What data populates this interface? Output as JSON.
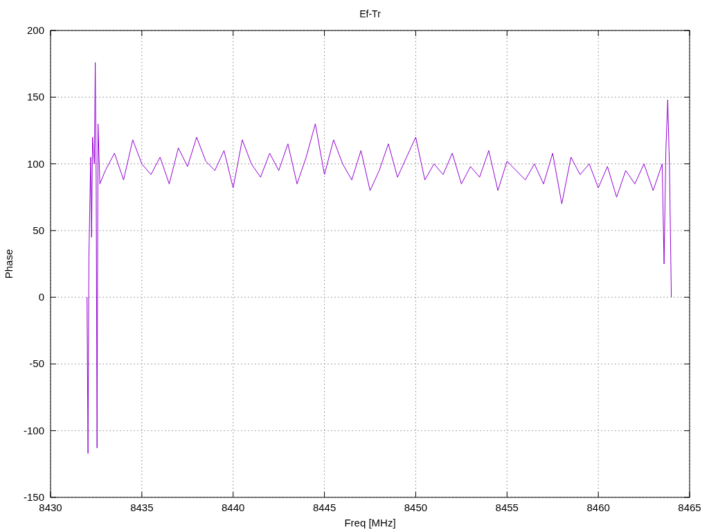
{
  "plot": {
    "chart_data": {
      "type": "line",
      "grid": true,
      "title": "Ef-Tr",
      "xlabel": "Freq [MHz]",
      "ylabel": "Phase",
      "xlim": [
        8430,
        8465
      ],
      "ylim": [
        -150,
        200
      ],
      "xticks": [
        8430,
        8435,
        8440,
        8445,
        8450,
        8455,
        8460,
        8465
      ],
      "yticks": [
        -150,
        -100,
        -50,
        0,
        50,
        100,
        150,
        200
      ],
      "x": [
        8432.0,
        8432.05,
        8432.1,
        8432.2,
        8432.25,
        8432.3,
        8432.4,
        8432.45,
        8432.5,
        8432.55,
        8432.6,
        8432.7,
        8433,
        8433.5,
        8434,
        8434.5,
        8435,
        8435.5,
        8436,
        8436.5,
        8437,
        8437.5,
        8438,
        8438.5,
        8439,
        8439.5,
        8440,
        8440.5,
        8441,
        8441.5,
        8442,
        8442.5,
        8443,
        8443.5,
        8444,
        8444.5,
        8445,
        8445.5,
        8446,
        8446.5,
        8447,
        8447.5,
        8448,
        8448.5,
        8449,
        8449.5,
        8450,
        8450.5,
        8451,
        8451.5,
        8452,
        8452.5,
        8453,
        8453.5,
        8454,
        8454.5,
        8455,
        8455.5,
        8456,
        8456.5,
        8457,
        8457.5,
        8458,
        8458.5,
        8459,
        8459.5,
        8460,
        8460.5,
        8461,
        8461.5,
        8462,
        8462.5,
        8463,
        8463.5,
        8463.6,
        8463.7,
        8463.8,
        8463.9,
        8464
      ],
      "series": [
        {
          "color": "#9400d3",
          "values": [
            0,
            -117,
            30,
            105,
            45,
            120,
            100,
            176,
            90,
            -113,
            130,
            85,
            95,
            108,
            88,
            118,
            100,
            92,
            105,
            85,
            112,
            98,
            120,
            102,
            95,
            110,
            82,
            118,
            100,
            90,
            108,
            95,
            115,
            85,
            105,
            130,
            92,
            118,
            100,
            88,
            110,
            80,
            95,
            115,
            90,
            105,
            120,
            88,
            100,
            92,
            108,
            85,
            98,
            90,
            110,
            80,
            102,
            95,
            88,
            100,
            85,
            108,
            70,
            105,
            92,
            100,
            82,
            98,
            75,
            95,
            85,
            100,
            80,
            100,
            25,
            110,
            148,
            95,
            0
          ]
        }
      ]
    }
  }
}
